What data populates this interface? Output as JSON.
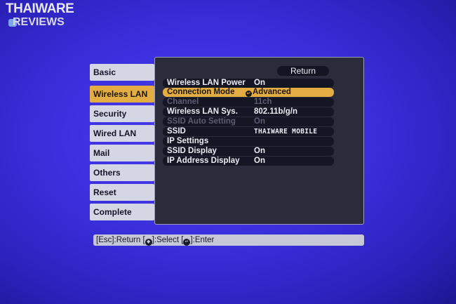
{
  "watermark": {
    "line1": "THAIWARE",
    "line2": "REVIEWS"
  },
  "tabs": [
    {
      "label": "Basic",
      "selected": false
    },
    {
      "label": "Wireless LAN",
      "selected": true
    },
    {
      "label": "Security",
      "selected": false
    },
    {
      "label": "Wired LAN",
      "selected": false
    },
    {
      "label": "Mail",
      "selected": false
    },
    {
      "label": "Others",
      "selected": false
    },
    {
      "label": "Reset",
      "selected": false
    },
    {
      "label": "Complete",
      "selected": false
    }
  ],
  "panel": {
    "return_label": "Return",
    "rows": [
      {
        "label": "Wireless LAN Power",
        "value": "On",
        "state": "normal"
      },
      {
        "label": "Connection Mode",
        "value": "Advanced",
        "state": "selected",
        "value_icon": "enter-icon"
      },
      {
        "label": "Channel",
        "value": "11ch",
        "state": "disabled"
      },
      {
        "label": "Wireless LAN Sys.",
        "value": "802.11b/g/n",
        "state": "normal"
      },
      {
        "label": "SSID Auto Setting",
        "value": "On",
        "state": "disabled"
      },
      {
        "label": "SSID",
        "value": "THAIWARE MOBILE",
        "state": "normal",
        "mono": true
      },
      {
        "label": "IP Settings",
        "value": "",
        "state": "normal"
      },
      {
        "label": "SSID Display",
        "value": "On",
        "state": "normal"
      },
      {
        "label": "IP Address Display",
        "value": "On",
        "state": "normal"
      }
    ]
  },
  "help_bar": {
    "esc": "[Esc]:Return",
    "select_open": "[",
    "select_close": "]:Select",
    "enter_open": "[",
    "enter_close": "]:Enter"
  },
  "colors": {
    "background": "#3b2fdc",
    "panel": "#2a2b3b",
    "row": "#151623",
    "highlight": "#e3ad44",
    "tab": "#d5d6e4",
    "disabled_text": "#5b5d72"
  }
}
